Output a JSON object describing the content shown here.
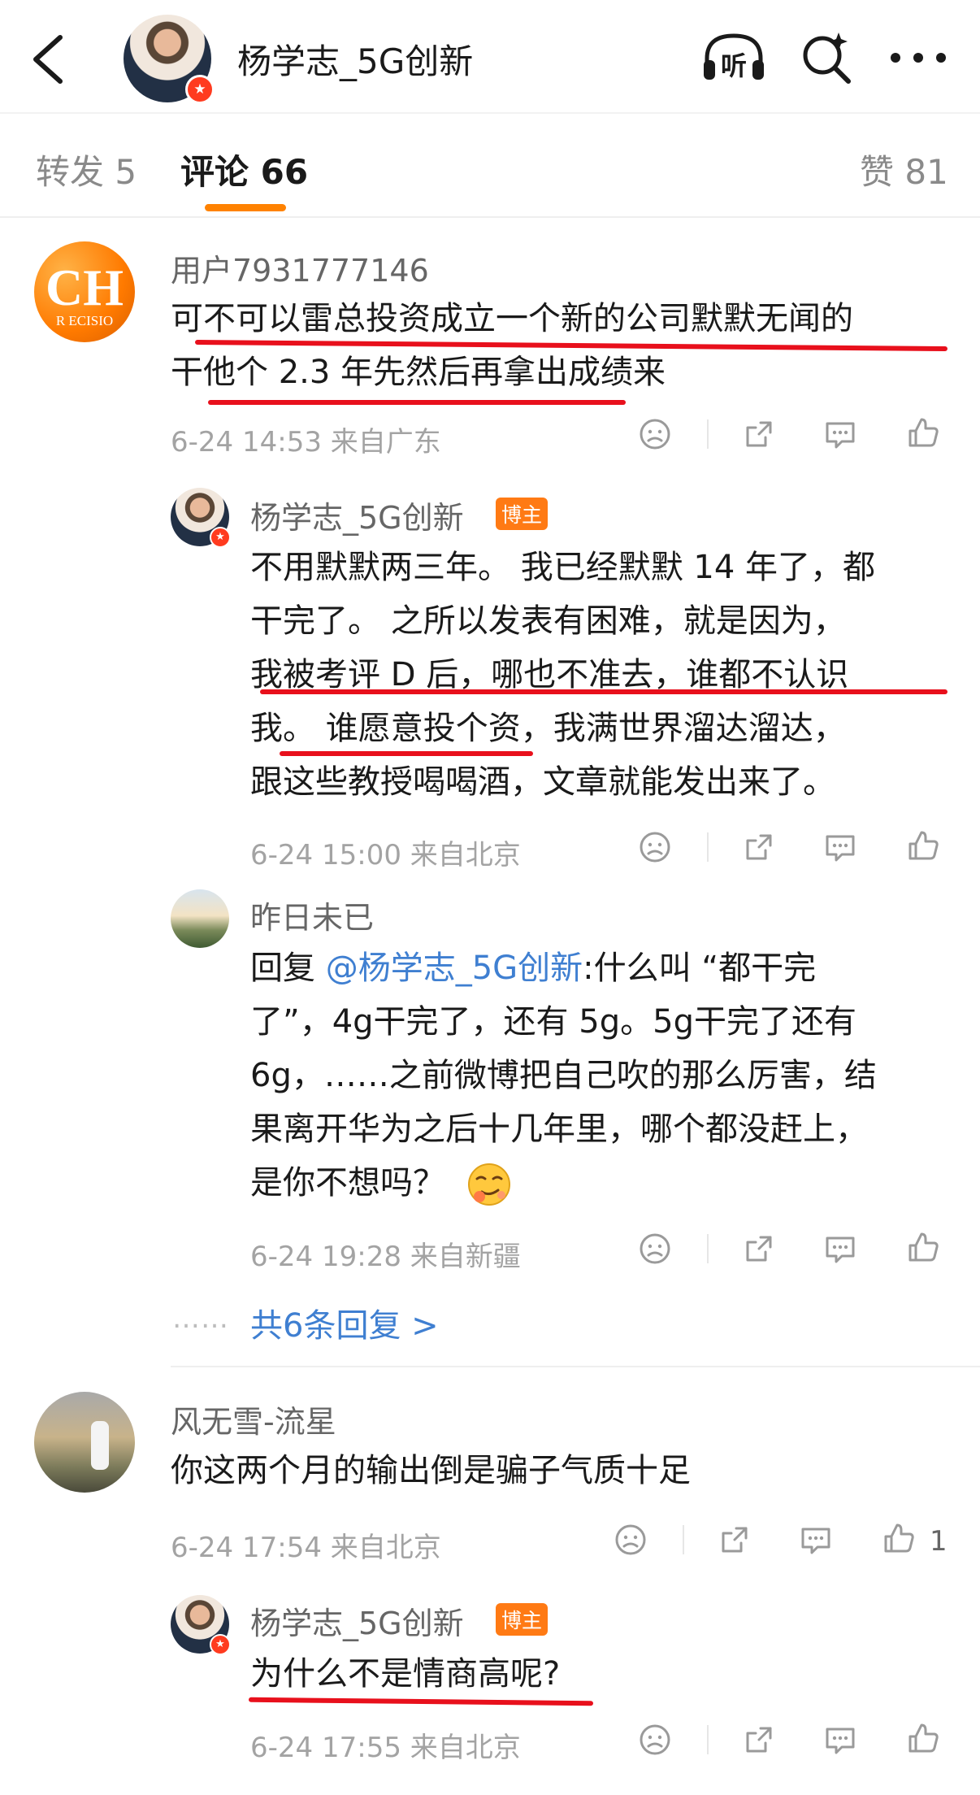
{
  "header": {
    "title": "杨学志_5G创新",
    "listen_label": "听",
    "verified_mark": "★"
  },
  "tabs": {
    "repost": "转发 5",
    "comments": "评论 66",
    "likes": "赞 81"
  },
  "comments": [
    {
      "user": "用户7931777146",
      "avatar_text": "CH",
      "avatar_subtext": "R ECISIO",
      "lines": [
        "可不可以雷总投资成立一个新的公司默默无闻的",
        "干他个 2.3 年先然后再拿出成绩来"
      ],
      "meta": "6-24 14:53 来自广东"
    },
    {
      "user": "杨学志_5G创新",
      "badge": "博主",
      "lines": [
        "不用默默两三年。 我已经默默 14 年了，都",
        "干完了。 之所以发表有困难，就是因为，",
        "我被考评 D 后，哪也不准去，谁都不认识",
        "我。 谁愿意投个资，我满世界溜达溜达，",
        "跟这些教授喝喝酒，文章就能发出来了。"
      ],
      "meta": "6-24 15:00 来自北京"
    },
    {
      "user": "昨日未已",
      "reply_prefix": "回复 ",
      "reply_link": "@杨学志_5G创新",
      "lines": [
        ":什么叫 “都干完",
        "了”，4g干完了，还有 5g。5g干完了还有",
        " 6g，……之前微博把自己吹的那么厉害，结",
        "果离开华为之后十几年里，哪个都没赶上，",
        "是你不想吗？"
      ],
      "meta": "6-24 19:28 来自新疆"
    },
    {
      "more_replies": "共6条回复 >",
      "dots": "……"
    },
    {
      "user": "风无雪-流星",
      "lines": [
        "你这两个月的输出倒是骗子气质十足"
      ],
      "meta": "6-24 17:54 来自北京",
      "like_count": "1"
    },
    {
      "user": "杨学志_5G创新",
      "badge": "博主",
      "lines": [
        "为什么不是情商高呢?"
      ],
      "meta": "6-24 17:55 来自北京"
    }
  ]
}
